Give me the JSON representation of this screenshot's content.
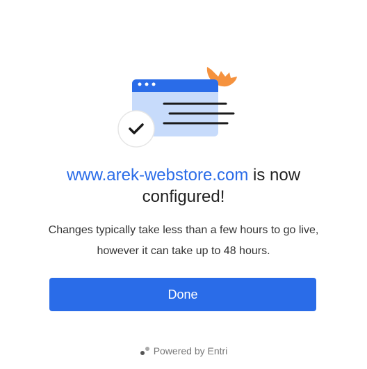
{
  "illustration": {
    "icon": "browser-window-configured-icon",
    "check_icon": "checkmark-icon",
    "accent_color": "#f5923e",
    "window_color": "#c7dbfb",
    "window_bar_color": "#2a6ce8"
  },
  "heading": {
    "domain": "www.arek-webstore.com",
    "suffix": " is now configured!"
  },
  "description": "Changes typically take less than a few hours to go live, however it can take up to 48 hours.",
  "done_button": {
    "label": "Done",
    "color": "#2a6ce8"
  },
  "footer": {
    "text": "Powered by Entri",
    "icon": "entri-logo-icon"
  }
}
